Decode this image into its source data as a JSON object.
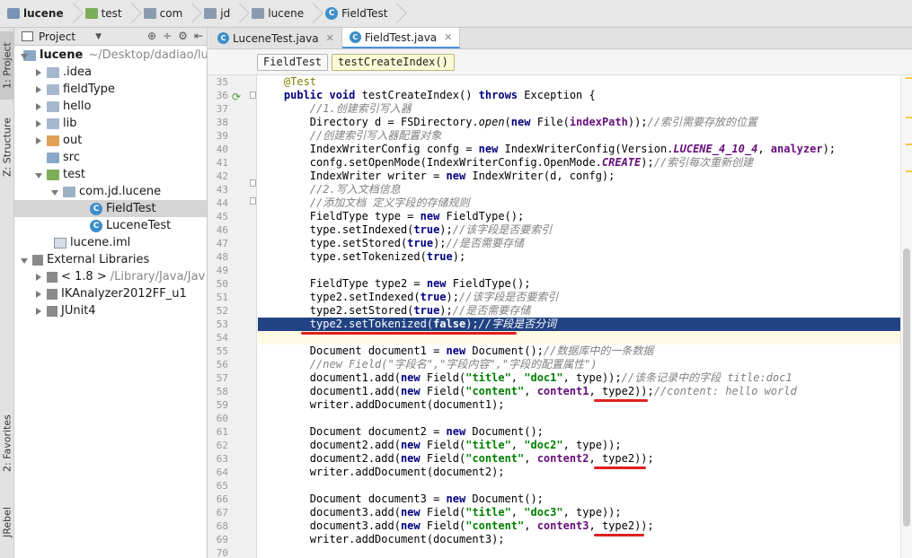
{
  "breadcrumb": [
    "lucene",
    "test",
    "com",
    "jd",
    "lucene",
    "FieldTest"
  ],
  "left_strip": {
    "project_tab": "1: Project",
    "structure_tab": "Z: Structure",
    "favorites_tab": "2: Favorites",
    "jrebel_tab": "JRebel"
  },
  "project_panel": {
    "title": "Project",
    "tree": [
      {
        "label": "lucene",
        "extra": "~/Desktop/dadiao/lu",
        "bold": true
      },
      {
        "label": ".idea"
      },
      {
        "label": "fieldType"
      },
      {
        "label": "hello"
      },
      {
        "label": "lib"
      },
      {
        "label": "out"
      },
      {
        "label": "src"
      },
      {
        "label": "test"
      },
      {
        "label": "com.jd.lucene"
      },
      {
        "label": "FieldTest"
      },
      {
        "label": "LuceneTest"
      },
      {
        "label": "lucene.iml"
      },
      {
        "label": "External Libraries"
      },
      {
        "label": "< 1.8 >",
        "extra": "/Library/Java/Jav"
      },
      {
        "label": "IKAnalyzer2012FF_u1"
      },
      {
        "label": "JUnit4"
      }
    ]
  },
  "tabs": [
    "LuceneTest.java",
    "FieldTest.java"
  ],
  "navbar": [
    "FieldTest",
    "testCreateIndex()"
  ],
  "line_numbers": [
    "35",
    "36",
    "37",
    "38",
    "39",
    "40",
    "41",
    "42",
    "43",
    "44",
    "45",
    "46",
    "47",
    "48",
    "49",
    "50",
    "51",
    "52",
    "53",
    "54",
    "55",
    "56",
    "57",
    "58",
    "59",
    "60",
    "61",
    "62",
    "63",
    "64",
    "65",
    "66",
    "67",
    "68",
    "69",
    "70"
  ]
}
